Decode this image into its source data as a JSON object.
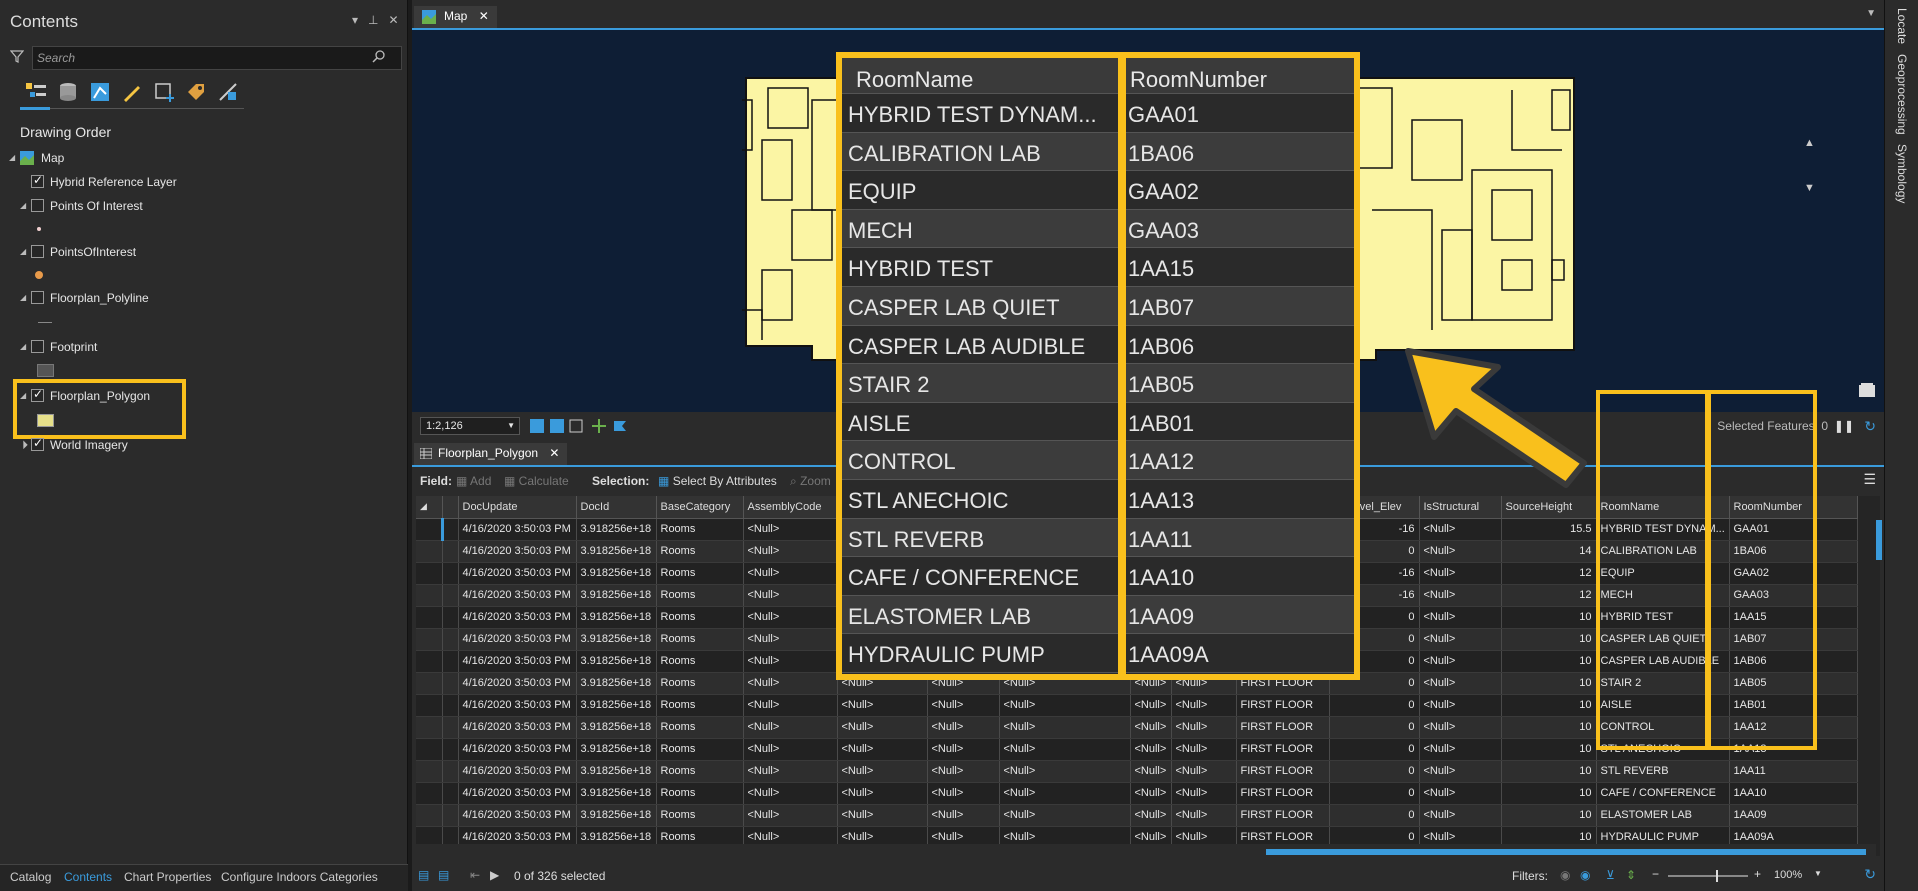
{
  "contents": {
    "title": "Contents",
    "search_placeholder": "Search",
    "section": "Drawing Order",
    "layers": [
      {
        "name": "Map"
      },
      {
        "name": "Hybrid Reference Layer"
      },
      {
        "name": "Points Of Interest"
      },
      {
        "name": "PointsOfInterest"
      },
      {
        "name": "Floorplan_Polyline"
      },
      {
        "name": "Footprint"
      },
      {
        "name": "Floorplan_Polygon"
      },
      {
        "name": "World Imagery"
      }
    ],
    "bottom_tabs": [
      "Catalog",
      "Contents",
      "Chart Properties",
      "Configure Indoors Categories"
    ]
  },
  "map": {
    "tab_label": "Map",
    "scale": "1:2,126",
    "selected_features": "Selected Features: 0"
  },
  "rail": [
    "Locate",
    "Geoprocessing",
    "Symbology"
  ],
  "table": {
    "tab_label": "Floorplan_Polygon",
    "toolbar": {
      "field": "Field:",
      "add": "Add",
      "calculate": "Calculate",
      "selection": "Selection:",
      "select_by_attributes": "Select By Attributes",
      "zoom": "Zoom"
    },
    "columns": [
      "DocUpdate",
      "DocId",
      "BaseCategory",
      "AssemblyCode",
      "",
      "",
      "",
      "",
      "",
      "",
      "ewLevel_Elev",
      "IsStructural",
      "SourceHeight",
      "RoomName",
      "RoomNumber"
    ],
    "rows": [
      [
        "4/16/2020 3:50:03 PM",
        "3.918256e+18",
        "Rooms",
        "<Null>",
        "",
        "",
        "",
        "",
        "",
        "",
        "-16",
        "<Null>",
        "15.5",
        "HYBRID TEST DYNAM...",
        "GAA01"
      ],
      [
        "4/16/2020 3:50:03 PM",
        "3.918256e+18",
        "Rooms",
        "<Null>",
        "",
        "",
        "",
        "",
        "",
        "",
        "0",
        "<Null>",
        "14",
        "CALIBRATION LAB",
        "1BA06"
      ],
      [
        "4/16/2020 3:50:03 PM",
        "3.918256e+18",
        "Rooms",
        "<Null>",
        "",
        "",
        "",
        "",
        "",
        "",
        "-16",
        "<Null>",
        "12",
        "EQUIP",
        "GAA02"
      ],
      [
        "4/16/2020 3:50:03 PM",
        "3.918256e+18",
        "Rooms",
        "<Null>",
        "",
        "",
        "",
        "",
        "",
        "",
        "-16",
        "<Null>",
        "12",
        "MECH",
        "GAA03"
      ],
      [
        "4/16/2020 3:50:03 PM",
        "3.918256e+18",
        "Rooms",
        "<Null>",
        "",
        "",
        "",
        "",
        "",
        "",
        "0",
        "<Null>",
        "10",
        "HYBRID TEST",
        "1AA15"
      ],
      [
        "4/16/2020 3:50:03 PM",
        "3.918256e+18",
        "Rooms",
        "<Null>",
        "",
        "",
        "",
        "",
        "",
        "",
        "0",
        "<Null>",
        "10",
        "CASPER LAB QUIET",
        "1AB07"
      ],
      [
        "4/16/2020 3:50:03 PM",
        "3.918256e+18",
        "Rooms",
        "<Null>",
        "",
        "",
        "",
        "",
        "",
        "",
        "0",
        "<Null>",
        "10",
        "CASPER LAB AUDIBLE",
        "1AB06"
      ],
      [
        "4/16/2020 3:50:03 PM",
        "3.918256e+18",
        "Rooms",
        "<Null>",
        "<Null>",
        "<Null>",
        "<Null>",
        "<Null>",
        "<Null>",
        "FIRST FLOOR",
        "0",
        "<Null>",
        "10",
        "STAIR 2",
        "1AB05"
      ],
      [
        "4/16/2020 3:50:03 PM",
        "3.918256e+18",
        "Rooms",
        "<Null>",
        "<Null>",
        "<Null>",
        "<Null>",
        "<Null>",
        "<Null>",
        "FIRST FLOOR",
        "0",
        "<Null>",
        "10",
        "AISLE",
        "1AB01"
      ],
      [
        "4/16/2020 3:50:03 PM",
        "3.918256e+18",
        "Rooms",
        "<Null>",
        "<Null>",
        "<Null>",
        "<Null>",
        "<Null>",
        "<Null>",
        "FIRST FLOOR",
        "0",
        "<Null>",
        "10",
        "CONTROL",
        "1AA12"
      ],
      [
        "4/16/2020 3:50:03 PM",
        "3.918256e+18",
        "Rooms",
        "<Null>",
        "<Null>",
        "<Null>",
        "<Null>",
        "<Null>",
        "<Null>",
        "FIRST FLOOR",
        "0",
        "<Null>",
        "10",
        "STL ANECHOIC",
        "1AA13"
      ],
      [
        "4/16/2020 3:50:03 PM",
        "3.918256e+18",
        "Rooms",
        "<Null>",
        "<Null>",
        "<Null>",
        "<Null>",
        "<Null>",
        "<Null>",
        "FIRST FLOOR",
        "0",
        "<Null>",
        "10",
        "STL REVERB",
        "1AA11"
      ],
      [
        "4/16/2020 3:50:03 PM",
        "3.918256e+18",
        "Rooms",
        "<Null>",
        "<Null>",
        "<Null>",
        "<Null>",
        "<Null>",
        "<Null>",
        "FIRST FLOOR",
        "0",
        "<Null>",
        "10",
        "CAFE / CONFERENCE",
        "1AA10"
      ],
      [
        "4/16/2020 3:50:03 PM",
        "3.918256e+18",
        "Rooms",
        "<Null>",
        "<Null>",
        "<Null>",
        "<Null>",
        "<Null>",
        "<Null>",
        "FIRST FLOOR",
        "0",
        "<Null>",
        "10",
        "ELASTOMER LAB",
        "1AA09"
      ],
      [
        "4/16/2020 3:50:03 PM",
        "3.918256e+18",
        "Rooms",
        "<Null>",
        "<Null>",
        "<Null>",
        "<Null>",
        "<Null>",
        "<Null>",
        "FIRST FLOOR",
        "0",
        "<Null>",
        "10",
        "HYDRAULIC PUMP",
        "1AA09A"
      ]
    ],
    "status": "0 of 326 selected",
    "filters": "Filters:",
    "zoom": "100%"
  },
  "callout": {
    "headers": [
      "RoomName",
      "RoomNumber"
    ],
    "rows": [
      [
        "HYBRID TEST DYNAM...",
        "GAA01"
      ],
      [
        "CALIBRATION LAB",
        "1BA06"
      ],
      [
        "EQUIP",
        "GAA02"
      ],
      [
        "MECH",
        "GAA03"
      ],
      [
        "HYBRID TEST",
        "1AA15"
      ],
      [
        "CASPER LAB QUIET",
        "1AB07"
      ],
      [
        "CASPER LAB AUDIBLE",
        "1AB06"
      ],
      [
        "STAIR 2",
        "1AB05"
      ],
      [
        "AISLE",
        "1AB01"
      ],
      [
        "CONTROL",
        "1AA12"
      ],
      [
        "STL ANECHOIC",
        "1AA13"
      ],
      [
        "STL REVERB",
        "1AA11"
      ],
      [
        "CAFE / CONFERENCE",
        "1AA10"
      ],
      [
        "ELASTOMER LAB",
        "1AA09"
      ],
      [
        "HYDRAULIC PUMP",
        "1AA09A"
      ]
    ]
  },
  "colors": {
    "highlight": "#f9c01c",
    "accent": "#3a9bdc",
    "floorplan": "#fbf5a4",
    "map_bg": "#0e1e35"
  }
}
